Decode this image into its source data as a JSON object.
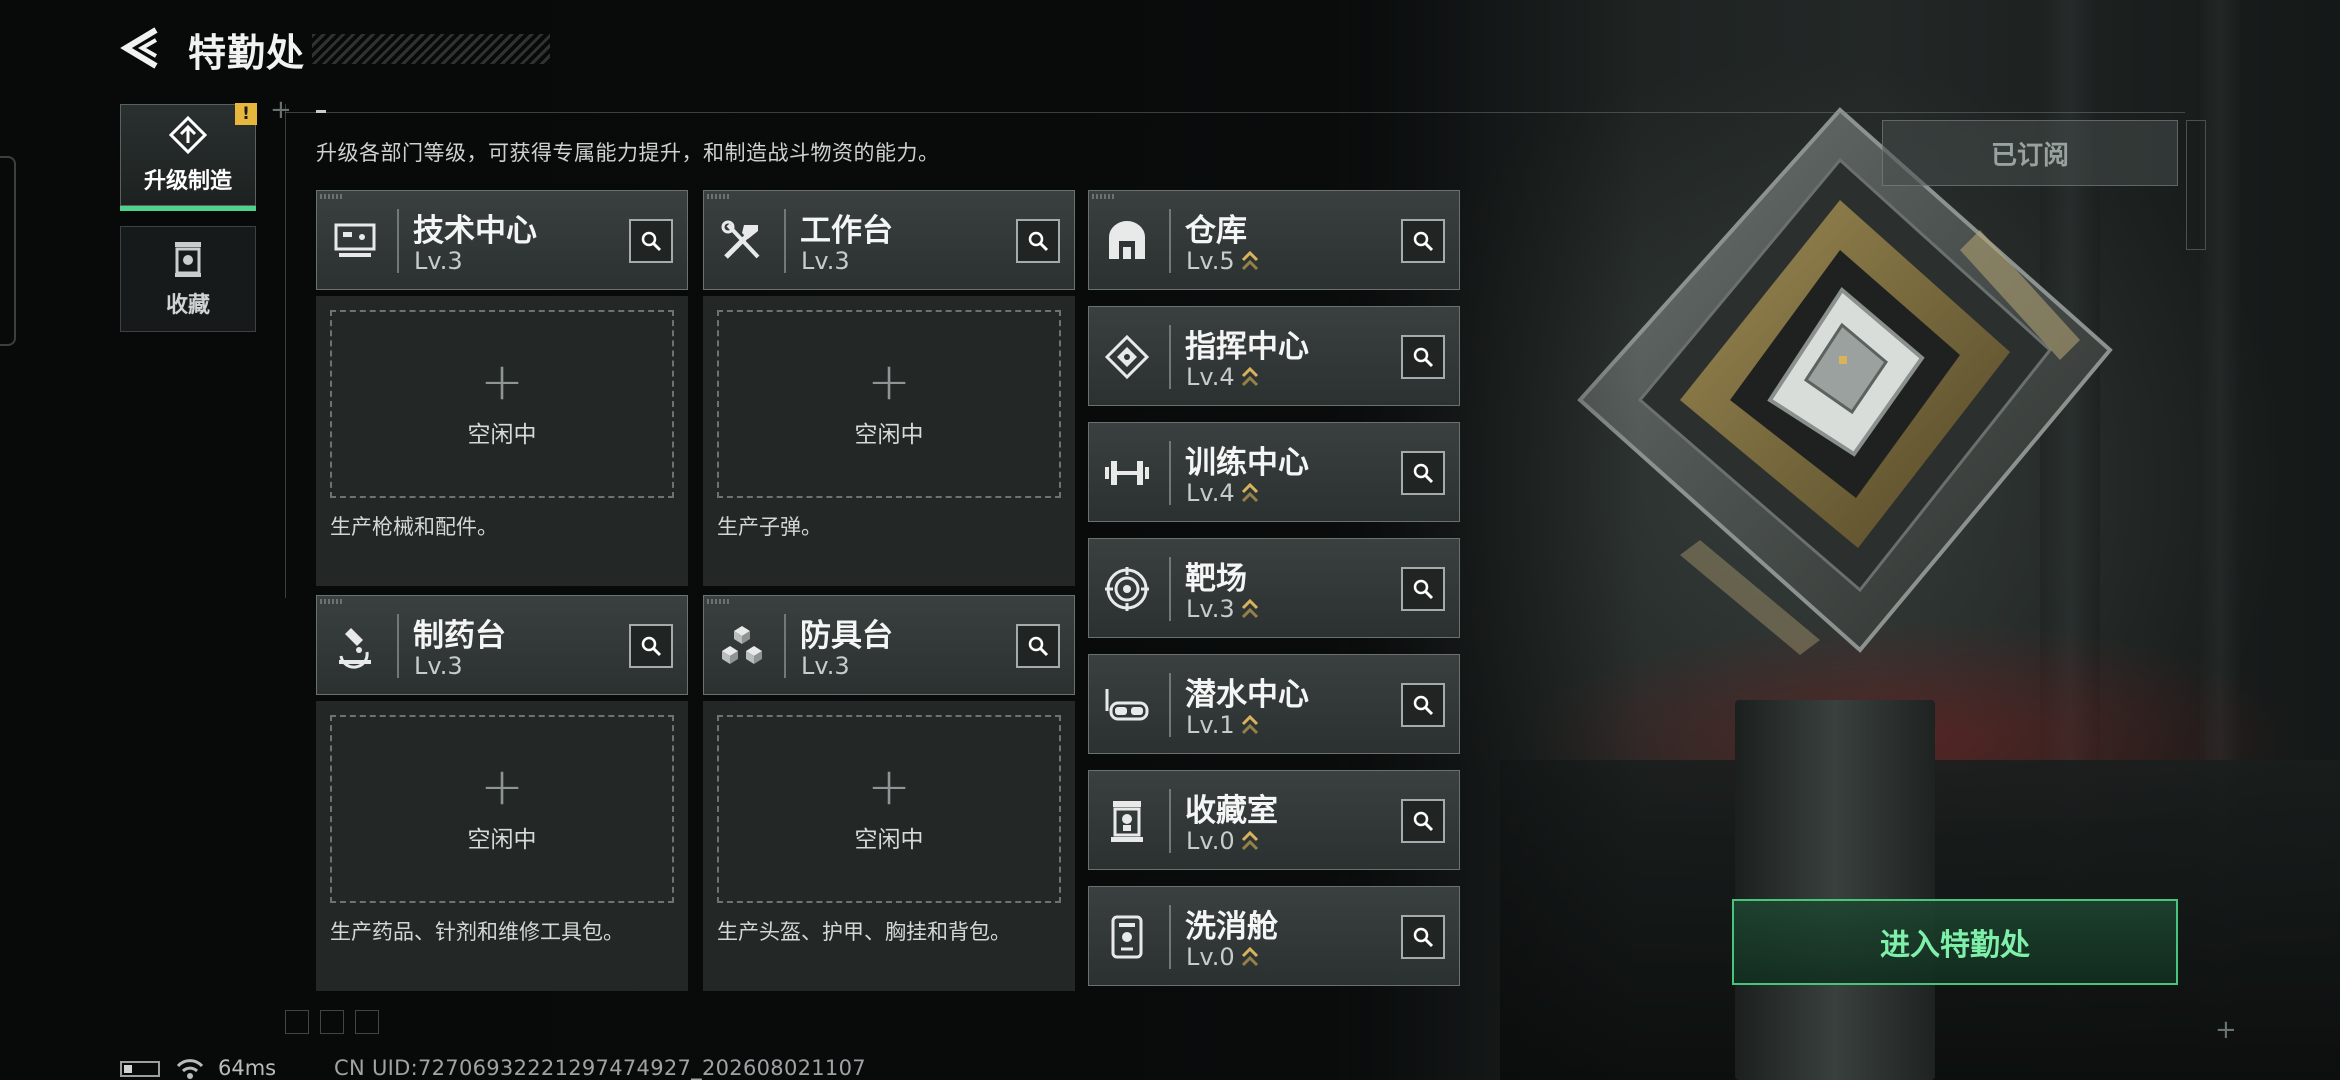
{
  "header": {
    "title": "特勤处",
    "back_icon": "back-arrow-icon"
  },
  "sidebar": {
    "tabs": [
      {
        "label": "升级制造",
        "icon": "upgrade-icon",
        "active": true,
        "badge": "!"
      },
      {
        "label": "收藏",
        "icon": "collection-jar-icon",
        "active": false
      }
    ]
  },
  "description": "升级各部门等级，可获得专属能力提升，和制造战斗物资的能力。",
  "workshops": [
    {
      "name": "技术中心",
      "level": "Lv.3",
      "icon": "tech-center-icon",
      "status": "空闲中",
      "desc": "生产枪械和配件。"
    },
    {
      "name": "工作台",
      "level": "Lv.3",
      "icon": "workbench-tools-icon",
      "status": "空闲中",
      "desc": "生产子弹。"
    },
    {
      "name": "制药台",
      "level": "Lv.3",
      "icon": "microscope-icon",
      "status": "空闲中",
      "desc": "生产药品、针剂和维修工具包。"
    },
    {
      "name": "防具台",
      "level": "Lv.3",
      "icon": "armor-cubes-icon",
      "status": "空闲中",
      "desc": "生产头盔、护甲、胸挂和背包。"
    }
  ],
  "facilities": [
    {
      "name": "仓库",
      "level": "Lv.5",
      "icon": "warehouse-icon"
    },
    {
      "name": "指挥中心",
      "level": "Lv.4",
      "icon": "command-center-icon"
    },
    {
      "name": "训练中心",
      "level": "Lv.4",
      "icon": "dumbbell-icon"
    },
    {
      "name": "靶场",
      "level": "Lv.3",
      "icon": "target-icon"
    },
    {
      "name": "潜水中心",
      "level": "Lv.1",
      "icon": "diving-mask-icon"
    },
    {
      "name": "收藏室",
      "level": "Lv.0",
      "icon": "collection-room-icon"
    },
    {
      "name": "洗消舱",
      "level": "Lv.0",
      "icon": "decon-pod-icon"
    }
  ],
  "right_panel": {
    "subscribed_label": "已订阅",
    "enter_label": "进入特勤处"
  },
  "footer": {
    "ping": "64ms",
    "uid": "CN UID:72706932221297474927_202608021107"
  },
  "colors": {
    "accent_green": "#4fd28b",
    "badge_yellow": "#e7b73d",
    "upgrade_chevron": "#d9b35a"
  }
}
